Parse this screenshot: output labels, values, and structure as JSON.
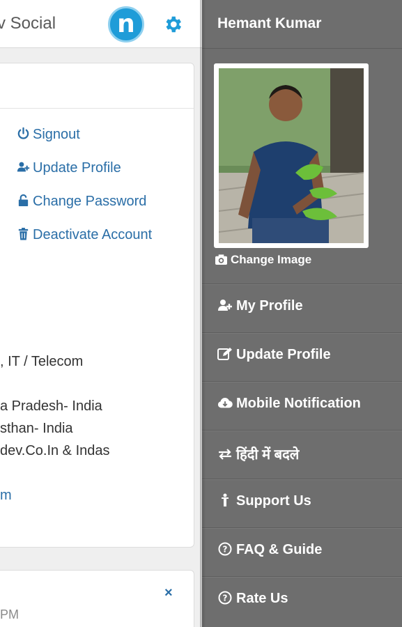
{
  "header": {
    "app_title": "v Social",
    "logo_letter": "n"
  },
  "account_menu": {
    "signout": "Signout",
    "update_profile": "Update Profile",
    "change_password": "Change Password",
    "deactivate_account": "Deactivate Account"
  },
  "profile_info": {
    "industry": ", IT / Telecom",
    "location1": "a Pradesh- India",
    "location2": "sthan- India",
    "company": "dev.Co.In & Indas",
    "website": "m"
  },
  "notification": {
    "close": "×",
    "time": "PM"
  },
  "drawer": {
    "user_name": "Hemant Kumar",
    "change_image": "Change Image",
    "items": [
      {
        "label": "My Profile",
        "icon": "user-plus-icon"
      },
      {
        "label": "Update Profile",
        "icon": "edit-icon"
      },
      {
        "label": "Mobile Notification",
        "icon": "cloud-download-icon"
      },
      {
        "label": "हिंदी में बदले",
        "icon": "exchange-icon"
      },
      {
        "label": "Support Us",
        "icon": "person-icon"
      },
      {
        "label": "FAQ & Guide",
        "icon": "question-circle-icon"
      },
      {
        "label": "Rate Us",
        "icon": "question-circle-icon"
      }
    ]
  },
  "colors": {
    "drawer_bg": "#6e6e6e",
    "link": "#2a6ea7",
    "brand": "#1f9cd8"
  }
}
